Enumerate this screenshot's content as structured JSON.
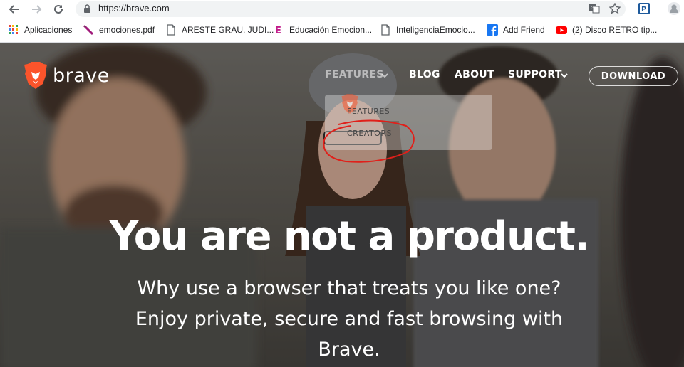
{
  "browser": {
    "url": "https://brave.com"
  },
  "bookmarks": [
    {
      "label": "Aplicaciones",
      "icon": "apps-grid-icon"
    },
    {
      "label": "emociones.pdf",
      "icon": "pdf-pen-icon"
    },
    {
      "label": "ARESTE GRAU, JUDI...",
      "icon": "document-icon"
    },
    {
      "label": "Educación Emocion...",
      "icon": "e-letter-icon"
    },
    {
      "label": "InteligenciaEmocio...",
      "icon": "document-icon"
    },
    {
      "label": "Add Friend",
      "icon": "facebook-icon"
    },
    {
      "label": "(2) Disco RETRO tip...",
      "icon": "youtube-icon"
    }
  ],
  "site": {
    "logo_text": "brave",
    "nav": {
      "features": "FEATURES",
      "blog": "BLOG",
      "about": "ABOUT",
      "support": "SUPPORT",
      "download": "DOWNLOAD"
    },
    "dropdown": {
      "items": [
        "FEATURES",
        "CREATORS"
      ]
    },
    "headline": "You are not a product.",
    "subline_1": "Why use a browser that treats you like one?",
    "subline_2": "Enjoy private, secure and fast browsing with",
    "subline_3": "Brave."
  },
  "colors": {
    "brand_orange": "#fb542b",
    "annotation_red": "#e0201a",
    "facebook_blue": "#1877f2",
    "youtube_red": "#ff0000"
  }
}
